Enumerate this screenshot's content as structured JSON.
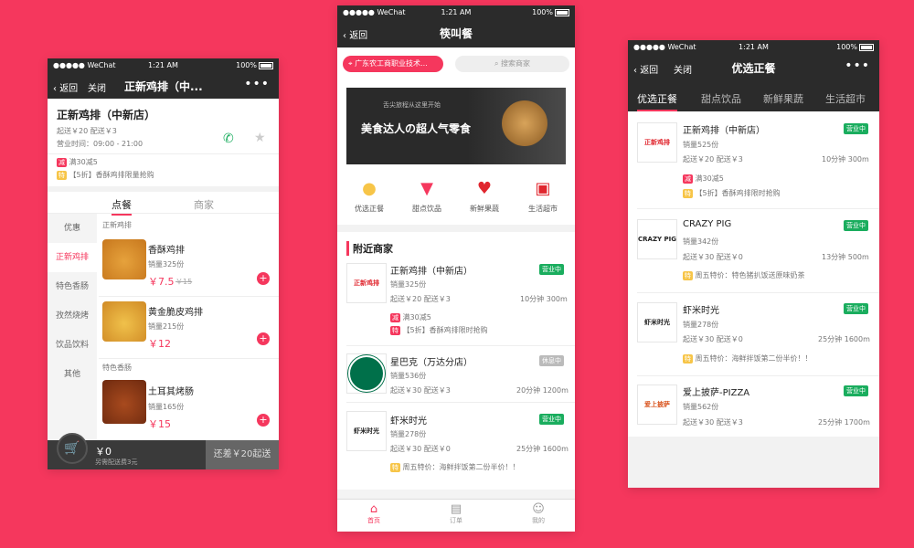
{
  "status": {
    "carrier": "●●●●● WeChat",
    "time": "1:21 AM",
    "battery": "100%"
  },
  "colors": {
    "background": "#f5375d",
    "accent": "#f5375d",
    "dark": "#2b2b2b",
    "green": "#1aad5e"
  },
  "left": {
    "nav": {
      "back": "返回",
      "close": "关闭",
      "title": "正新鸡排（中..."
    },
    "shop": {
      "name": "正新鸡排（中新店）",
      "delivery": "起送￥20   配送￥3",
      "hours": "营业时间：09:00 - 21:00",
      "promo1_tag": "减",
      "promo1": "满30减5",
      "promo2_tag": "特",
      "promo2": "【5折】香酥鸡排限量抢购"
    },
    "tabs": [
      "点餐",
      "商家"
    ],
    "categories": [
      "优惠",
      "正新鸡排",
      "特色香肠",
      "孜然烧烤",
      "饮品饮料",
      "其他"
    ],
    "section1": "正新鸡排",
    "section2": "特色香肠",
    "items": [
      {
        "name": "香酥鸡排",
        "sales": "销量325份",
        "price": "￥7.5",
        "old": "￥15"
      },
      {
        "name": "黄金脆皮鸡排",
        "sales": "销量215份",
        "price": "￥12",
        "old": ""
      },
      {
        "name": "土耳其烤肠",
        "sales": "销量165份",
        "price": "￥15",
        "old": ""
      }
    ],
    "cart": {
      "total": "￥0",
      "note": "另需配送费3元",
      "btn": "还差￥20起送"
    }
  },
  "mid": {
    "nav": {
      "back": "返回",
      "title": "筷叫餐"
    },
    "location": "广东农工商职业技术...",
    "search_placeholder": "搜索商家",
    "banner": {
      "small": "舌尖旅程从这里开始",
      "big": "美食达人の超人气零食"
    },
    "cats": [
      "优选正餐",
      "甜点饮品",
      "新鲜果蔬",
      "生活超市"
    ],
    "nearby": "附近商家",
    "shops": [
      {
        "logo": "正新鸡排",
        "name": "正新鸡排（中新店）",
        "status": "营业中",
        "sales": "销量325份",
        "fee": "起送￥20   配送￥3",
        "time": "10分钟",
        "dist": "300m",
        "t1": "减",
        "p1": "满30减5",
        "t2": "特",
        "p2": "【5折】香酥鸡排限时抢购"
      },
      {
        "logo": "STARBUCKS",
        "name": "星巴克（万达分店）",
        "status": "休息中",
        "sales": "销量536份",
        "fee": "起送￥30   配送￥3",
        "time": "20分钟",
        "dist": "1200m"
      },
      {
        "logo": "虾米时光",
        "name": "虾米时光",
        "status": "营业中",
        "sales": "销量278份",
        "fee": "起送￥30   配送￥0",
        "time": "25分钟",
        "dist": "1600m",
        "t1": "特",
        "p1": "周五特价：海鲜拌饭第二份半价！！"
      }
    ],
    "tabbar": [
      "首页",
      "订单",
      "我的"
    ]
  },
  "right": {
    "nav": {
      "back": "返回",
      "close": "关闭",
      "title": "优选正餐"
    },
    "tabs": [
      "优选正餐",
      "甜点饮品",
      "新鲜果蔬",
      "生活超市"
    ],
    "shops": [
      {
        "logo": "正新鸡排",
        "name": "正新鸡排（中新店）",
        "status": "营业中",
        "sales": "销量525份",
        "fee": "起送￥20   配送￥3",
        "time": "10分钟",
        "dist": "300m",
        "t1": "减",
        "p1": "满30减5",
        "t2": "特",
        "p2": "【5折】香酥鸡排限时抢购"
      },
      {
        "logo": "CRAZY PIG",
        "name": "CRAZY PIG",
        "status": "营业中",
        "sales": "销量342份",
        "fee": "起送￥30   配送￥0",
        "time": "13分钟",
        "dist": "500m",
        "t1": "特",
        "p1": "周五特价：特色猪扒饭送原味奶茶"
      },
      {
        "logo": "虾米时光",
        "name": "虾米时光",
        "status": "营业中",
        "sales": "销量278份",
        "fee": "起送￥30   配送￥0",
        "time": "25分钟",
        "dist": "1600m",
        "t1": "特",
        "p1": "周五特价：海鲜拌饭第二份半价！！"
      },
      {
        "logo": "爱上披萨",
        "name": "爱上披萨-PIZZA",
        "status": "营业中",
        "sales": "销量562份",
        "fee": "起送￥30   配送￥3",
        "time": "25分钟",
        "dist": "1700m"
      }
    ]
  }
}
